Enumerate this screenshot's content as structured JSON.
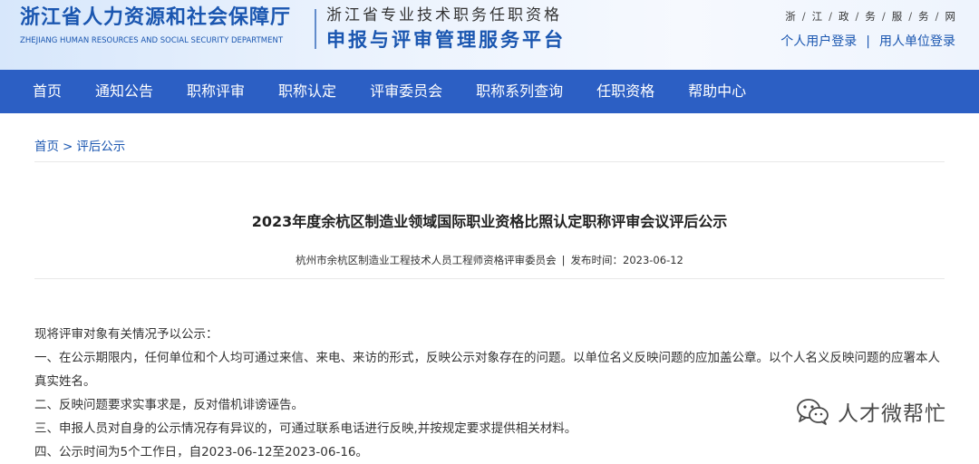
{
  "header": {
    "dept_cn": "浙江省人力资源和社会保障厅",
    "dept_en": "ZHEJIANG HUMAN RESOURCES AND SOCIAL SECURITY DEPARTMENT",
    "platform_sub": "浙江省专业技术职务任职资格",
    "platform_main": "申报与评审管理服务平台",
    "site_links": [
      "浙",
      "江",
      "政",
      "务",
      "服",
      "务",
      "网"
    ],
    "login_personal": "个人用户登录",
    "login_sep": "|",
    "login_unit": "用人单位登录"
  },
  "nav": {
    "items": [
      "首页",
      "通知公告",
      "职称评审",
      "职称认定",
      "评审委员会",
      "职称系列查询",
      "任职资格",
      "帮助中心"
    ]
  },
  "breadcrumb": {
    "home": "首页",
    "sep": ">",
    "current": "评后公示"
  },
  "article": {
    "title": "2023年度余杭区制造业领域国际职业资格比照认定职称评审会议评后公示",
    "publisher": "杭州市余杭区制造业工程技术人员工程师资格评审委员会",
    "meta_sep": "|",
    "publish_label": "发布时间：",
    "publish_date": "2023-06-12",
    "paragraphs": [
      "现将评审对象有关情况予以公示：",
      "一、在公示期限内，任何单位和个人均可通过来信、来电、来访的形式，反映公示对象存在的问题。以单位名义反映问题的应加盖公章。以个人名义反映问题的应署本人真实姓名。",
      "二、反映问题要求实事求是，反对借机诽谤诬告。",
      "三、申报人员对自身的公示情况存有异议的，可通过联系电话进行反映,并按规定要求提供相关材料。",
      "四、公示时间为5个工作日，自2023-06-12至2023-06-16。"
    ]
  },
  "watermark": {
    "text": "人才微帮忙",
    "icon": "wechat-icon"
  },
  "colors": {
    "brand_blue": "#1a56b0",
    "nav_bg": "#2c5fc4"
  }
}
